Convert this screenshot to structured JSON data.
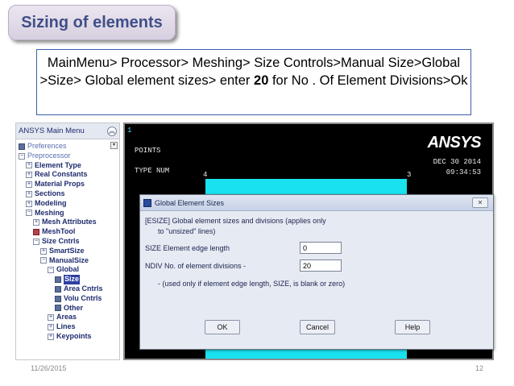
{
  "slide": {
    "title": "Sizing of elements",
    "instruction": {
      "before_bold": "MainMenu> Processor> Meshing> Size Controls>Manual Size>Global >Size> Global element sizes> enter ",
      "bold_value": "20",
      "after_bold": " for No . Of Element Divisions>Ok"
    },
    "footer_date": "11/26/2015",
    "page_number": "12"
  },
  "main_menu": {
    "title": "ANSYS Main Menu",
    "collapse_icon": "double-chevron-up-icon",
    "items": [
      {
        "label": "Preferences",
        "icon": "doc",
        "indent": 0,
        "top": true
      },
      {
        "label": "Preprocessor",
        "icon": "minus",
        "indent": 0,
        "top": true
      },
      {
        "label": "Element Type",
        "icon": "plus",
        "indent": 1
      },
      {
        "label": "Real Constants",
        "icon": "plus",
        "indent": 1
      },
      {
        "label": "Material Props",
        "icon": "plus",
        "indent": 1
      },
      {
        "label": "Sections",
        "icon": "plus",
        "indent": 1
      },
      {
        "label": "Modeling",
        "icon": "plus",
        "indent": 1
      },
      {
        "label": "Meshing",
        "icon": "minus",
        "indent": 1
      },
      {
        "label": "Mesh Attributes",
        "icon": "plus",
        "indent": 2
      },
      {
        "label": "MeshTool",
        "icon": "doc-red",
        "indent": 2
      },
      {
        "label": "Size Cntrls",
        "icon": "minus",
        "indent": 2
      },
      {
        "label": "SmartSize",
        "icon": "plus",
        "indent": 3
      },
      {
        "label": "ManualSize",
        "icon": "minus",
        "indent": 3
      },
      {
        "label": "Global",
        "icon": "minus",
        "indent": 4
      },
      {
        "label": "Size",
        "icon": "doc",
        "indent": 5,
        "selected": true
      },
      {
        "label": "Area Cntrls",
        "icon": "doc",
        "indent": 5
      },
      {
        "label": "Volu Cntrls",
        "icon": "doc",
        "indent": 5
      },
      {
        "label": "Other",
        "icon": "doc",
        "indent": 5
      },
      {
        "label": "Areas",
        "icon": "plus",
        "indent": 4
      },
      {
        "label": "Lines",
        "icon": "plus",
        "indent": 4
      },
      {
        "label": "Keypoints",
        "icon": "plus",
        "indent": 4
      }
    ]
  },
  "graphics": {
    "window_number": "1",
    "label_points": "POINTS",
    "label_type_num": "TYPE NUM",
    "point_4": "4",
    "point_3": "3",
    "logo": "ANSYS",
    "date": "DEC 30 2014",
    "time": "09:34:53",
    "fill_color": "#19e1ee"
  },
  "dialog": {
    "title": "Global Element Sizes",
    "close_icon": "close-icon",
    "header_line1": "[ESIZE]  Global element sizes and divisions (applies only",
    "header_line2": "to \"unsized\" lines)",
    "size_label": "SIZE  Element edge length",
    "size_value": "0",
    "ndiv_label": "NDIV  No. of element divisions -",
    "ndiv_value": "20",
    "note": "- (used only if element edge length, SIZE, is blank or zero)",
    "ok_label": "OK",
    "cancel_label": "Cancel",
    "help_label": "Help"
  }
}
